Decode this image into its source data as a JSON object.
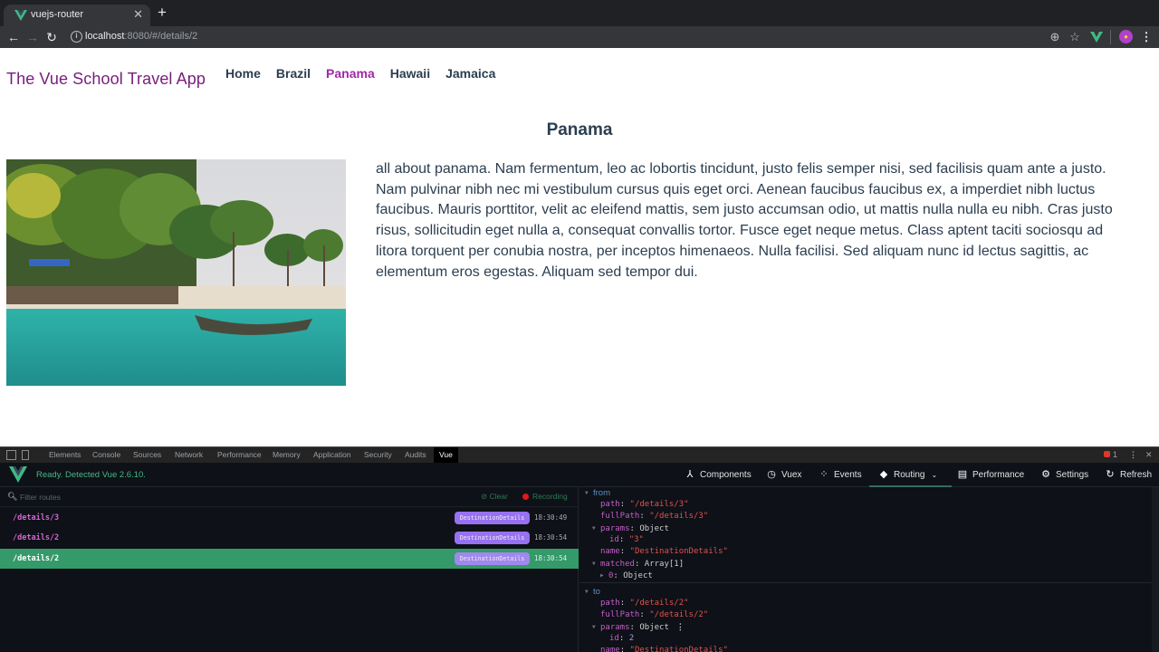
{
  "browser": {
    "tab_title": "vuejs-router",
    "address_host": "localhost",
    "address_rest": ":8080/#/details/2",
    "icons": {
      "back": "arrow-left-icon",
      "forward": "arrow-right-icon",
      "reload": "reload-icon",
      "info": "info-icon",
      "zoom": "zoom-icon",
      "bookmark": "star-icon",
      "vue_extension": "vue-icon",
      "profile": "avatar-icon",
      "menu": "kebab-menu-icon"
    }
  },
  "app": {
    "brand": "The Vue School Travel App",
    "nav": [
      {
        "label": "Home",
        "active": false
      },
      {
        "label": "Brazil",
        "active": false
      },
      {
        "label": "Panama",
        "active": true
      },
      {
        "label": "Hawaii",
        "active": false
      },
      {
        "label": "Jamaica",
        "active": false
      }
    ],
    "destination": {
      "title": "Panama",
      "description": "all about panama. Nam fermentum, leo ac lobortis tincidunt, justo felis semper nisi, sed facilisis quam ante a justo. Nam pulvinar nibh nec mi vestibulum cursus quis eget orci. Aenean faucibus faucibus ex, a imperdiet nibh luctus faucibus. Mauris porttitor, velit ac eleifend mattis, sem justo accumsan odio, ut mattis nulla nulla eu nibh. Cras justo risus, sollicitudin eget nulla a, consequat convallis tortor. Fusce eget neque metus. Class aptent taciti sociosqu ad litora torquent per conubia nostra, per inceptos himenaeos. Nulla facilisi. Sed aliquam nunc id lectus sagittis, ac elementum eros egestas. Aliquam sed tempor dui."
    }
  },
  "devtools": {
    "tabs": [
      "Elements",
      "Console",
      "Sources",
      "Network",
      "Performance",
      "Memory",
      "Application",
      "Security",
      "Audits",
      "Vue"
    ],
    "active_tab": "Vue",
    "error_count": "1",
    "vue": {
      "status": "Ready. Detected Vue 2.6.10.",
      "nav": [
        {
          "label": "Components",
          "icon": "components-icon"
        },
        {
          "label": "Vuex",
          "icon": "history-icon"
        },
        {
          "label": "Events",
          "icon": "events-icon"
        },
        {
          "label": "Routing",
          "icon": "routing-icon",
          "active": true
        },
        {
          "label": "Performance",
          "icon": "performance-icon"
        },
        {
          "label": "Settings",
          "icon": "settings-icon"
        },
        {
          "label": "Refresh",
          "icon": "refresh-icon"
        }
      ],
      "filter_placeholder": "Filter routes",
      "clear_label": "Clear",
      "recording_label": "Recording",
      "history": [
        {
          "path": "/details/3",
          "name": "DestinationDetails",
          "time": "18:30:49",
          "selected": false
        },
        {
          "path": "/details/2",
          "name": "DestinationDetails",
          "time": "18:30:54",
          "selected": false
        },
        {
          "path": "/details/2",
          "name": "DestinationDetails",
          "time": "18:30:54",
          "selected": true
        }
      ],
      "inspector": {
        "from": {
          "label": "from",
          "path": "\"/details/3\"",
          "fullPath": "\"/details/3\"",
          "params_type": "Object",
          "params_id": "\"3\"",
          "name": "\"DestinationDetails\"",
          "matched_type": "Array[1]",
          "matched_0": "Object"
        },
        "to": {
          "label": "to",
          "path": "\"/details/2\"",
          "fullPath": "\"/details/2\"",
          "params_type": "Object",
          "params_id": "2",
          "name": "\"DestinationDetails\""
        },
        "keys": {
          "path": "path",
          "fullPath": "fullPath",
          "params": "params",
          "id": "id",
          "name": "name",
          "matched": "matched",
          "zero": "0"
        }
      }
    }
  }
}
